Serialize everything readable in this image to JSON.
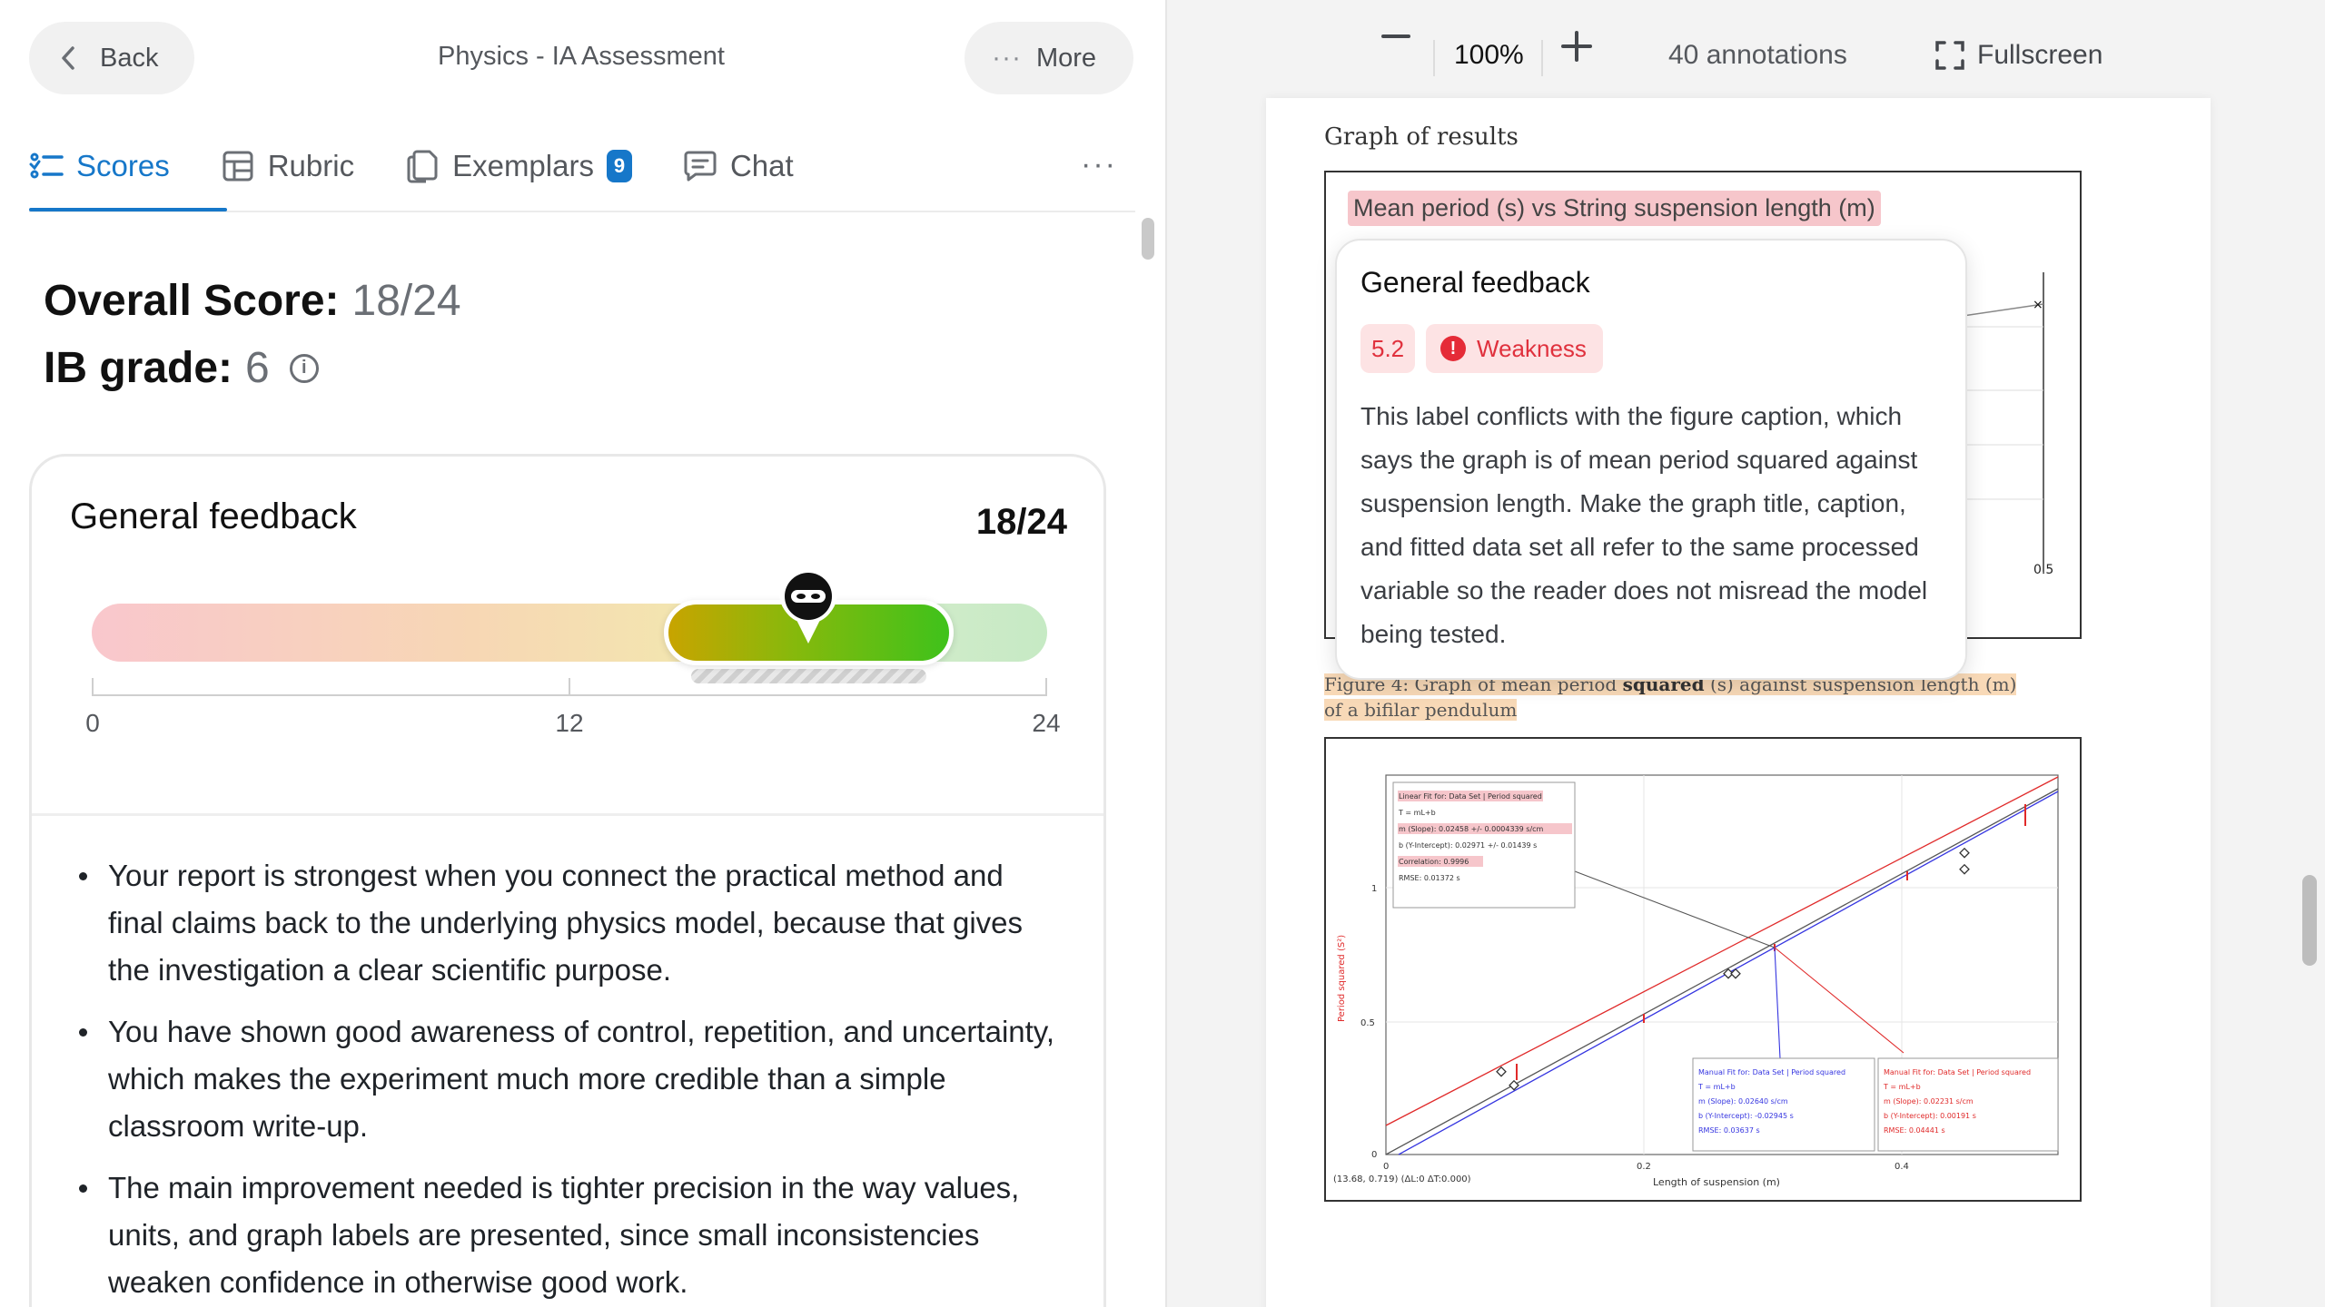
{
  "header": {
    "back_label": "Back",
    "doc_title": "Physics - IA Assessment",
    "more_label": "More"
  },
  "tabs": [
    {
      "label": "Scores",
      "icon": "list-check-icon",
      "active": true
    },
    {
      "label": "Rubric",
      "icon": "table-icon",
      "active": false
    },
    {
      "label": "Exemplars",
      "icon": "documents-icon",
      "active": false,
      "badge": "9"
    },
    {
      "label": "Chat",
      "icon": "chat-icon",
      "active": false
    }
  ],
  "scores": {
    "overall_label": "Overall Score:",
    "overall_value": "18/24",
    "ib_label": "IB grade:",
    "ib_value": "6"
  },
  "feedback_card": {
    "title": "General feedback",
    "score": "18/24",
    "gauge": {
      "min": 0,
      "max": 24,
      "value": 18,
      "range_low": 15,
      "range_high": 21,
      "ticks": [
        "0",
        "12",
        "24"
      ]
    },
    "bullets": [
      "Your report is strongest when you connect the practical method and final claims back to the underlying physics model, because that gives the investigation a clear scientific purpose.",
      "You have shown good awareness of control, repetition, and uncertainty, which makes the experiment much more credible than a simple classroom write-up.",
      "The main improvement needed is tighter precision in the way values, units, and graph labels are presented, since small inconsistencies weaken confidence in otherwise good work."
    ]
  },
  "viewer": {
    "zoom": "100%",
    "annotations": "40 annotations",
    "fullscreen_label": "Fullscreen"
  },
  "document": {
    "graph_heading": "Graph of results",
    "chart1_title": "Mean period (s) vs String suspension length (m)",
    "chart1_tick": "0.5",
    "caption_pre": "Figure 4: Graph of mean period ",
    "caption_bold": "squared",
    "caption_post": " (s) against suspension length (m) of a bifilar pendulum",
    "chart2": {
      "ylabel": "Period squared (S²)",
      "xlabel": "Length of suspension (m)",
      "corner_readout": "(13.68, 0.719) (ΔL:0 ΔT:0.000)",
      "yticks": [
        "0",
        "0.5",
        "1"
      ],
      "xticks": [
        "0",
        "0.2",
        "0.4"
      ],
      "box_linear": [
        "Linear Fit for: Data Set | Period squared",
        "T = mL+b",
        "m (Slope): 0.02458 +/- 0.0004339 s/cm",
        "b (Y-Intercept): 0.02971 +/- 0.01439 s",
        "Correlation: 0.9996",
        "RMSE: 0.01372 s"
      ],
      "box_manual_blue": [
        "Manual Fit for: Data Set | Period squared",
        "T = mL+b",
        "m (Slope): 0.02640 s/cm",
        "b (Y-Intercept): -0.02945 s",
        "RMSE: 0.03637 s"
      ],
      "box_manual_red": [
        "Manual Fit for: Data Set | Period squared",
        "T = mL+b",
        "m (Slope): 0.02231 s/cm",
        "b (Y-Intercept): 0.00191 s",
        "RMSE: 0.04441 s"
      ]
    }
  },
  "popup": {
    "title": "General feedback",
    "criterion": "5.2",
    "tag": "Weakness",
    "body": "This label conflicts with the figure caption, which says the graph is of mean period squared against suspension length. Make the graph title, caption, and fitted data set all refer to the same processed variable so the reader does not misread the model being tested."
  },
  "colors": {
    "accent": "#1677c9",
    "weakness": "#e0313d"
  }
}
